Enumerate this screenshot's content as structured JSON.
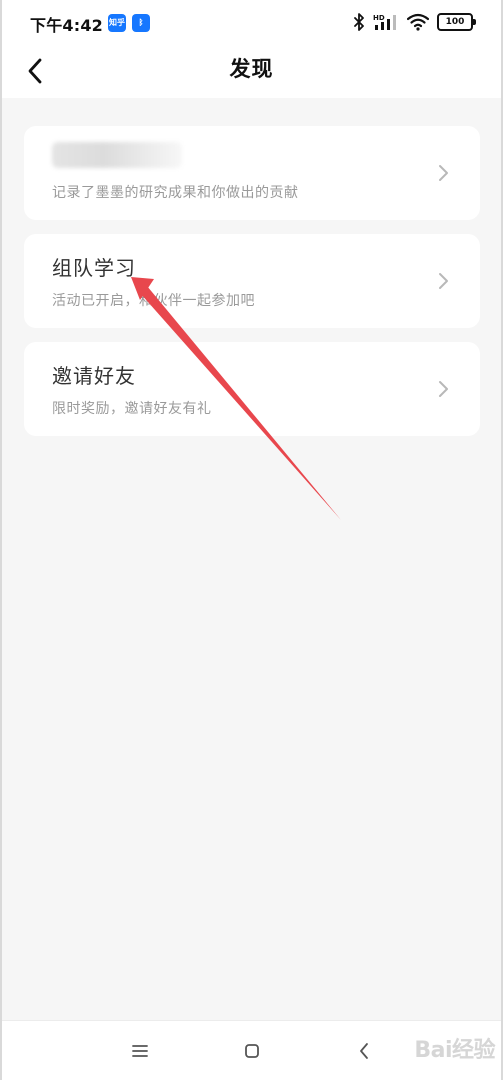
{
  "status_bar": {
    "time": "下午4:42",
    "app_badge_1": "知乎",
    "app_badge_2": "ᛒ",
    "network_label": "HD",
    "battery": "100"
  },
  "header": {
    "title": "发现",
    "back_icon": "chevron-left-icon"
  },
  "cards": [
    {
      "title": "",
      "subtitle": "记录了墨墨的研究成果和你做出的贡献"
    },
    {
      "title": "组队学习",
      "subtitle": "活动已开启，和伙伴一起参加吧"
    },
    {
      "title": "邀请好友",
      "subtitle": "限时奖励，邀请好友有礼"
    }
  ],
  "nav": {
    "menu_icon": "menu-icon",
    "home_icon": "home-square-icon",
    "back_icon": "back-triangle-icon"
  },
  "watermark": "Bai经验",
  "colors": {
    "background": "#f6f6f6",
    "card": "#ffffff",
    "title_text": "#333333",
    "subtitle_text": "#9a9a9a",
    "annotation_arrow": "#e8474d",
    "badge_blue": "#1677ff"
  }
}
